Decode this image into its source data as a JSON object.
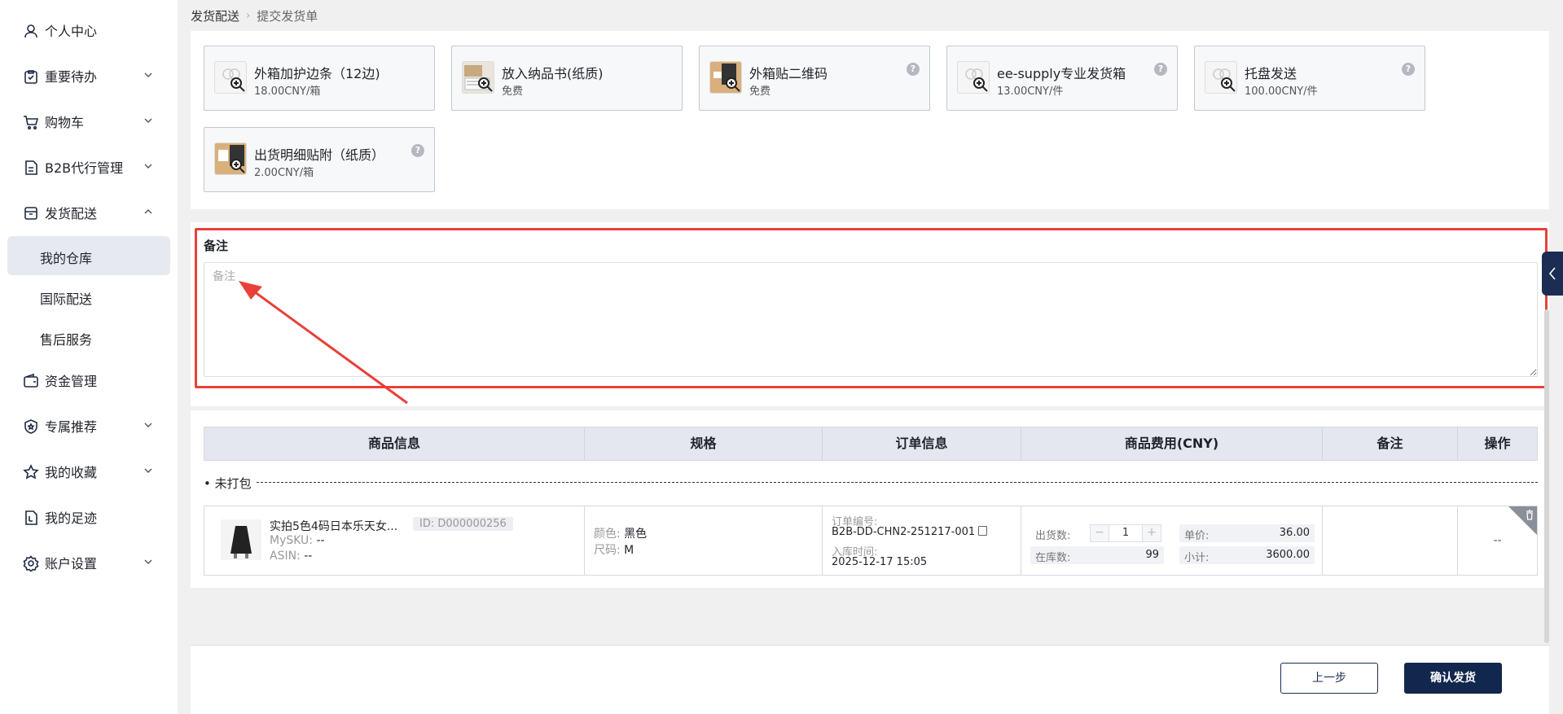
{
  "sidebar": {
    "items": [
      {
        "label": "个人中心",
        "icon": "user-icon"
      },
      {
        "label": "重要待办",
        "icon": "clipboard-check-icon"
      },
      {
        "label": "购物车",
        "icon": "cart-icon"
      },
      {
        "label": "B2B代行管理",
        "icon": "document-icon"
      },
      {
        "label": "发货配送",
        "icon": "box-icon"
      },
      {
        "label": "资金管理",
        "icon": "wallet-icon"
      },
      {
        "label": "专属推荐",
        "icon": "badge-icon"
      },
      {
        "label": "我的收藏",
        "icon": "star-icon"
      },
      {
        "label": "我的足迹",
        "icon": "footprint-icon"
      },
      {
        "label": "账户设置",
        "icon": "gear-icon"
      }
    ],
    "sub_items": [
      {
        "label": "我的仓库",
        "active": true
      },
      {
        "label": "国际配送",
        "active": false
      },
      {
        "label": "售后服务",
        "active": false
      }
    ]
  },
  "breadcrumb": {
    "parent": "发货配送",
    "current": "提交发货单"
  },
  "services": [
    {
      "name": "外箱加护边条（12边)",
      "price": "18.00CNY/箱",
      "help": false
    },
    {
      "name": "放入纳品书(纸质)",
      "price": "免费",
      "help": false
    },
    {
      "name": "外箱贴二维码",
      "price": "免费",
      "help": true
    },
    {
      "name": "ee-supply专业发货箱",
      "price": "13.00CNY/件",
      "help": true
    },
    {
      "name": "托盘发送",
      "price": "100.00CNY/件",
      "help": true
    },
    {
      "name": "出货明细贴附（纸质）",
      "price": "2.00CNY/箱",
      "help": true
    }
  ],
  "remark": {
    "title": "备注",
    "placeholder": "备注"
  },
  "table": {
    "headers": [
      "商品信息",
      "规格",
      "订单信息",
      "商品费用(CNY)",
      "备注",
      "操作"
    ],
    "group_label": "未打包",
    "row": {
      "product_name": "实拍5色4码日本乐天女...",
      "product_id": "ID: D000000256",
      "mysku_label": "MySKU:",
      "mysku_value": "--",
      "asin_label": "ASIN:",
      "asin_value": "--",
      "color_label": "颜色:",
      "color_value": "黑色",
      "size_label": "尺码:",
      "size_value": "M",
      "order_no_label": "订单编号:",
      "order_no": "B2B-DD-CHN2-251217-001",
      "inbound_label": "入库时间:",
      "inbound_time": "2025-12-17 15:05",
      "ship_qty_label": "出货数:",
      "ship_qty": "1",
      "stock_label": "在库数:",
      "stock_qty": "99",
      "unit_price_label": "单价:",
      "unit_price": "36.00",
      "subtotal_label": "小计:",
      "subtotal": "3600.00",
      "remark": "",
      "operation": "--"
    }
  },
  "footer": {
    "prev_label": "上一步",
    "confirm_label": "确认发货"
  },
  "colors": {
    "accent": "#12274e",
    "highlight": "#e8413a"
  }
}
